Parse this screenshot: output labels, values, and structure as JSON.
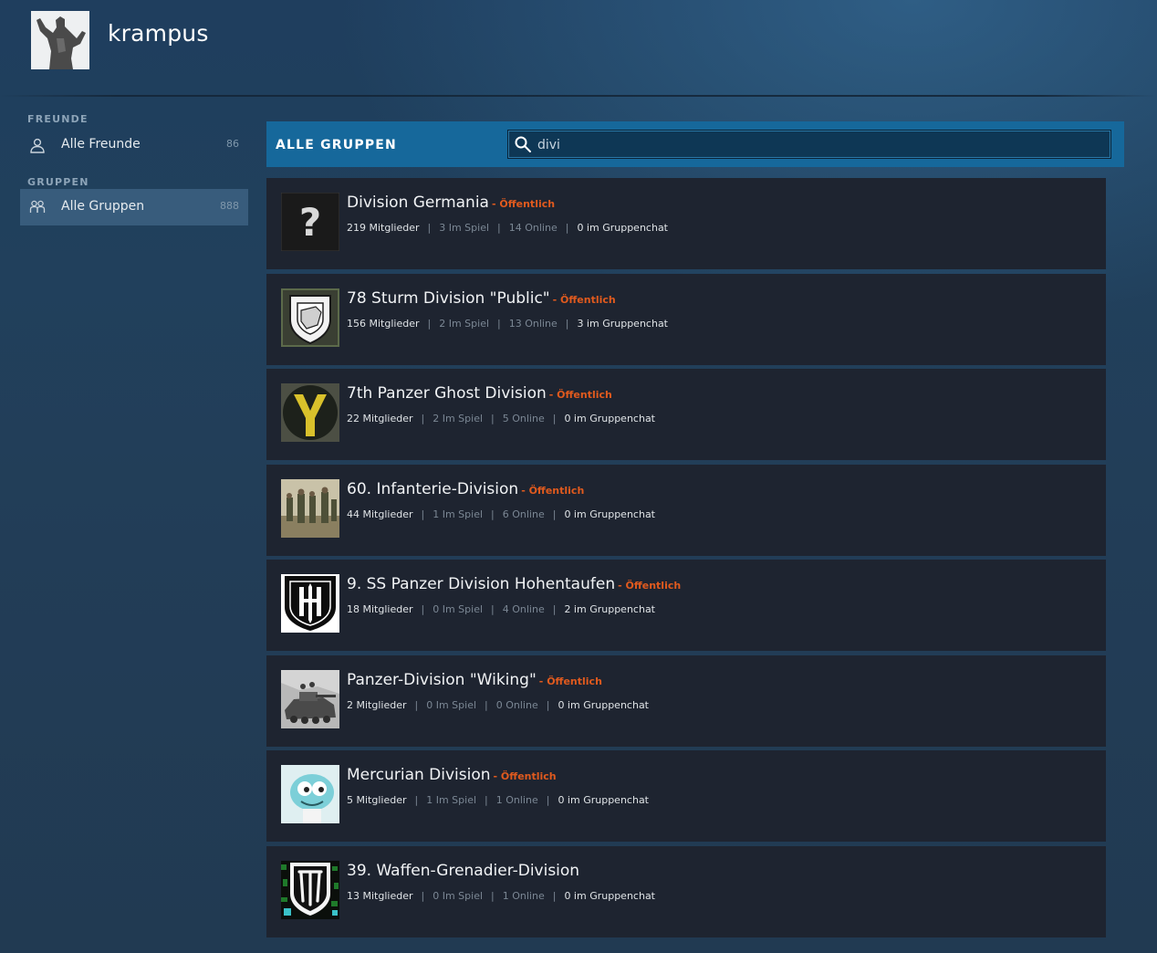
{
  "profile": {
    "username": "krampus"
  },
  "sidebar": {
    "friends_heading": "FREUNDE",
    "groups_heading": "GRUPPEN",
    "items": [
      {
        "label": "Alle Freunde",
        "count": "86",
        "icon": "user-icon"
      },
      {
        "label": "Alle Gruppen",
        "count": "888",
        "icon": "group-icon",
        "active": true
      }
    ]
  },
  "groups_panel": {
    "title": "ALLE GRUPPEN",
    "search_value": "divi"
  },
  "groups": [
    {
      "name": "Division Germania",
      "badge": "- Öffentlich",
      "members": "219 Mitglieder",
      "in_game": "3 Im Spiel",
      "online": "14 Online",
      "chat": "0 im Gruppenchat"
    },
    {
      "name": "78 Sturm Division \"Public\"",
      "badge": "- Öffentlich",
      "members": "156 Mitglieder",
      "in_game": "2 Im Spiel",
      "online": "13 Online",
      "chat": "3 im Gruppenchat"
    },
    {
      "name": "7th Panzer Ghost Division",
      "badge": "- Öffentlich",
      "members": "22 Mitglieder",
      "in_game": "2 Im Spiel",
      "online": "5 Online",
      "chat": "0 im Gruppenchat"
    },
    {
      "name": "60. Infanterie-Division",
      "badge": "- Öffentlich",
      "members": "44 Mitglieder",
      "in_game": "1 Im Spiel",
      "online": "6 Online",
      "chat": "0 im Gruppenchat"
    },
    {
      "name": "9. SS Panzer Division Hohentaufen",
      "badge": "- Öffentlich",
      "members": "18 Mitglieder",
      "in_game": "0 Im Spiel",
      "online": "4 Online",
      "chat": "2 im Gruppenchat"
    },
    {
      "name": "Panzer-Division \"Wiking\"",
      "badge": "- Öffentlich",
      "members": "2 Mitglieder",
      "in_game": "0 Im Spiel",
      "online": "0 Online",
      "chat": "0 im Gruppenchat"
    },
    {
      "name": "Mercurian Division",
      "badge": "- Öffentlich",
      "members": "5 Mitglieder",
      "in_game": "1 Im Spiel",
      "online": "1 Online",
      "chat": "0 im Gruppenchat"
    },
    {
      "name": "39. Waffen-Grenadier-Division",
      "badge": "",
      "members": "13 Mitglieder",
      "in_game": "0 Im Spiel",
      "online": "1 Online",
      "chat": "0 im Gruppenchat"
    }
  ],
  "colors": {
    "accent_bar": "#16689b",
    "badge": "#e05a1e",
    "row_bg": "#1e2430",
    "active_item": "#385c7c"
  }
}
